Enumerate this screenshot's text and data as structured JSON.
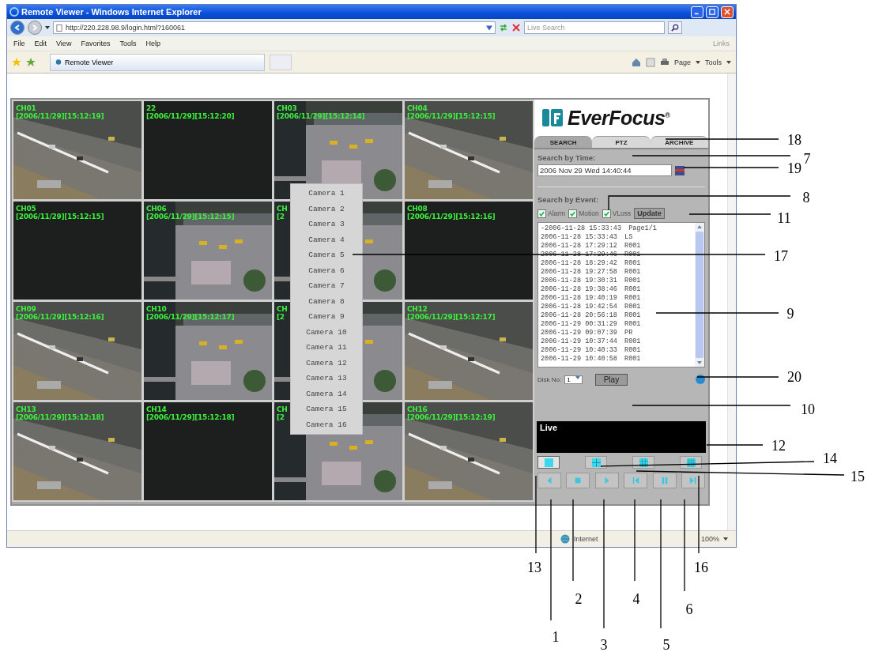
{
  "window": {
    "title": "Remote Viewer - Windows Internet Explorer"
  },
  "address_bar": {
    "url": "http://220.228.98.9/login.html?160061",
    "search_placeholder": "Live Search"
  },
  "menu": [
    "File",
    "Edit",
    "View",
    "Favorites",
    "Tools",
    "Help"
  ],
  "links_label": "Links",
  "browser_tab": {
    "label": "Remote Viewer"
  },
  "command_bar": {
    "page": "Page",
    "tools": "Tools"
  },
  "cameras": [
    {
      "channel": "CH01",
      "time": "[2006/11/29][15:12:19]",
      "kind": "picture"
    },
    {
      "channel": "22",
      "time": "[2006/11/29][15:12:20]",
      "kind": "empty"
    },
    {
      "channel": "CH03",
      "time": "[2006/11/29][15:12:14]",
      "kind": "picture"
    },
    {
      "channel": "CH04",
      "time": "[2006/11/29][15:12:15]",
      "kind": "picture"
    },
    {
      "channel": "CH05",
      "time": "[2006/11/29][15:12:15]",
      "kind": "empty"
    },
    {
      "channel": "CH06",
      "time": "[2006/11/29][15:12:15]",
      "kind": "picture"
    },
    {
      "channel": "CH",
      "time": "[2",
      "kind": "picture"
    },
    {
      "channel": "CH08",
      "time": "[2006/11/29][15:12:16]",
      "kind": "empty"
    },
    {
      "channel": "CH09",
      "time": "[2006/11/29][15:12:16]",
      "kind": "picture"
    },
    {
      "channel": "CH10",
      "time": "[2006/11/29][15:12:17]",
      "kind": "picture"
    },
    {
      "channel": "CH",
      "time": "[2",
      "kind": "picture"
    },
    {
      "channel": "CH12",
      "time": "[2006/11/29][15:12:17]",
      "kind": "picture"
    },
    {
      "channel": "CH13",
      "time": "[2006/11/29][15:12:18]",
      "kind": "picture"
    },
    {
      "channel": "CH14",
      "time": "[2006/11/29][15:12:18]",
      "kind": "empty"
    },
    {
      "channel": "CH",
      "time": "[2",
      "kind": "picture"
    },
    {
      "channel": "CH16",
      "time": "[2006/11/29][15:12:19]",
      "kind": "picture"
    }
  ],
  "camera_menu": [
    "Camera 1",
    "Camera 2",
    "Camera 3",
    "Camera 4",
    "Camera 5",
    "Camera 6",
    "Camera 7",
    "Camera 8",
    "Camera 9",
    "Camera 10",
    "Camera 11",
    "Camera 12",
    "Camera 13",
    "Camera 14",
    "Camera 15",
    "Camera 16"
  ],
  "logo": "EverFocus$^{®}$",
  "tabs": [
    {
      "label": "SEARCH",
      "selected": true
    },
    {
      "label": "PTZ",
      "selected": false
    },
    {
      "label": "ARCHIVE",
      "selected": false
    }
  ],
  "search_by_time": {
    "label": "Search by Time:",
    "value": "2006 Nov 29 Wed 14:40:44"
  },
  "search_by_event": {
    "label": "Search by Event:",
    "filters": [
      {
        "label": "Alarm",
        "checked": true
      },
      {
        "label": "Motion",
        "checked": true
      },
      {
        "label": "VLoss",
        "checked": true
      }
    ],
    "update_button": "Update"
  },
  "events": [
    {
      "date": "-2006-11-28",
      "time": "15:33:43",
      "code": "Page1/1"
    },
    {
      "date": "2006-11-28",
      "time": "15:33:43",
      "code": "LS"
    },
    {
      "date": "2006-11-28",
      "time": "17:29:12",
      "code": "R001"
    },
    {
      "date": "2006-11-28",
      "time": "17:29:46",
      "code": "R001"
    },
    {
      "date": "2006-11-28",
      "time": "18:29:42",
      "code": "R001"
    },
    {
      "date": "2006-11-28",
      "time": "19:27:58",
      "code": "R001"
    },
    {
      "date": "2006-11-28",
      "time": "19:30:31",
      "code": "R001"
    },
    {
      "date": "2006-11-28",
      "time": "19:38:46",
      "code": "R001"
    },
    {
      "date": "2006-11-28",
      "time": "19:40:19",
      "code": "R001"
    },
    {
      "date": "2006-11-28",
      "time": "19:42:54",
      "code": "R001"
    },
    {
      "date": "2006-11-28",
      "time": "20:56:18",
      "code": "R001"
    },
    {
      "date": "2006-11-29",
      "time": "00:31:29",
      "code": "R001"
    },
    {
      "date": "2006-11-29",
      "time": "09:07:39",
      "code": "PR"
    },
    {
      "date": "2006-11-29",
      "time": "10:37:44",
      "code": "R001"
    },
    {
      "date": "2006-11-29",
      "time": "10:40:33",
      "code": "R001"
    },
    {
      "date": "2006-11-29",
      "time": "10:40:58",
      "code": "R001"
    }
  ],
  "disk": {
    "label": "Disk No:",
    "value": "1"
  },
  "play_button": "Play",
  "live_label": "Live",
  "layout_buttons": [
    {
      "kind": "single",
      "selected": true
    },
    {
      "kind": "quad",
      "selected": false
    },
    {
      "kind": "nine",
      "selected": false
    },
    {
      "kind": "sixteen",
      "selected": false
    }
  ],
  "playback_buttons": [
    {
      "kind": "reverse"
    },
    {
      "kind": "stop"
    },
    {
      "kind": "play"
    },
    {
      "kind": "step-back"
    },
    {
      "kind": "pause"
    },
    {
      "kind": "step-forward"
    }
  ],
  "status_bar": {
    "zone": "Internet",
    "zoom": "100%"
  },
  "callouts": [
    "18",
    "7",
    "19",
    "8",
    "11",
    "17",
    "9",
    "20",
    "10",
    "12",
    "14",
    "15",
    "13",
    "16",
    "2",
    "4",
    "6",
    "1",
    "3",
    "5"
  ]
}
